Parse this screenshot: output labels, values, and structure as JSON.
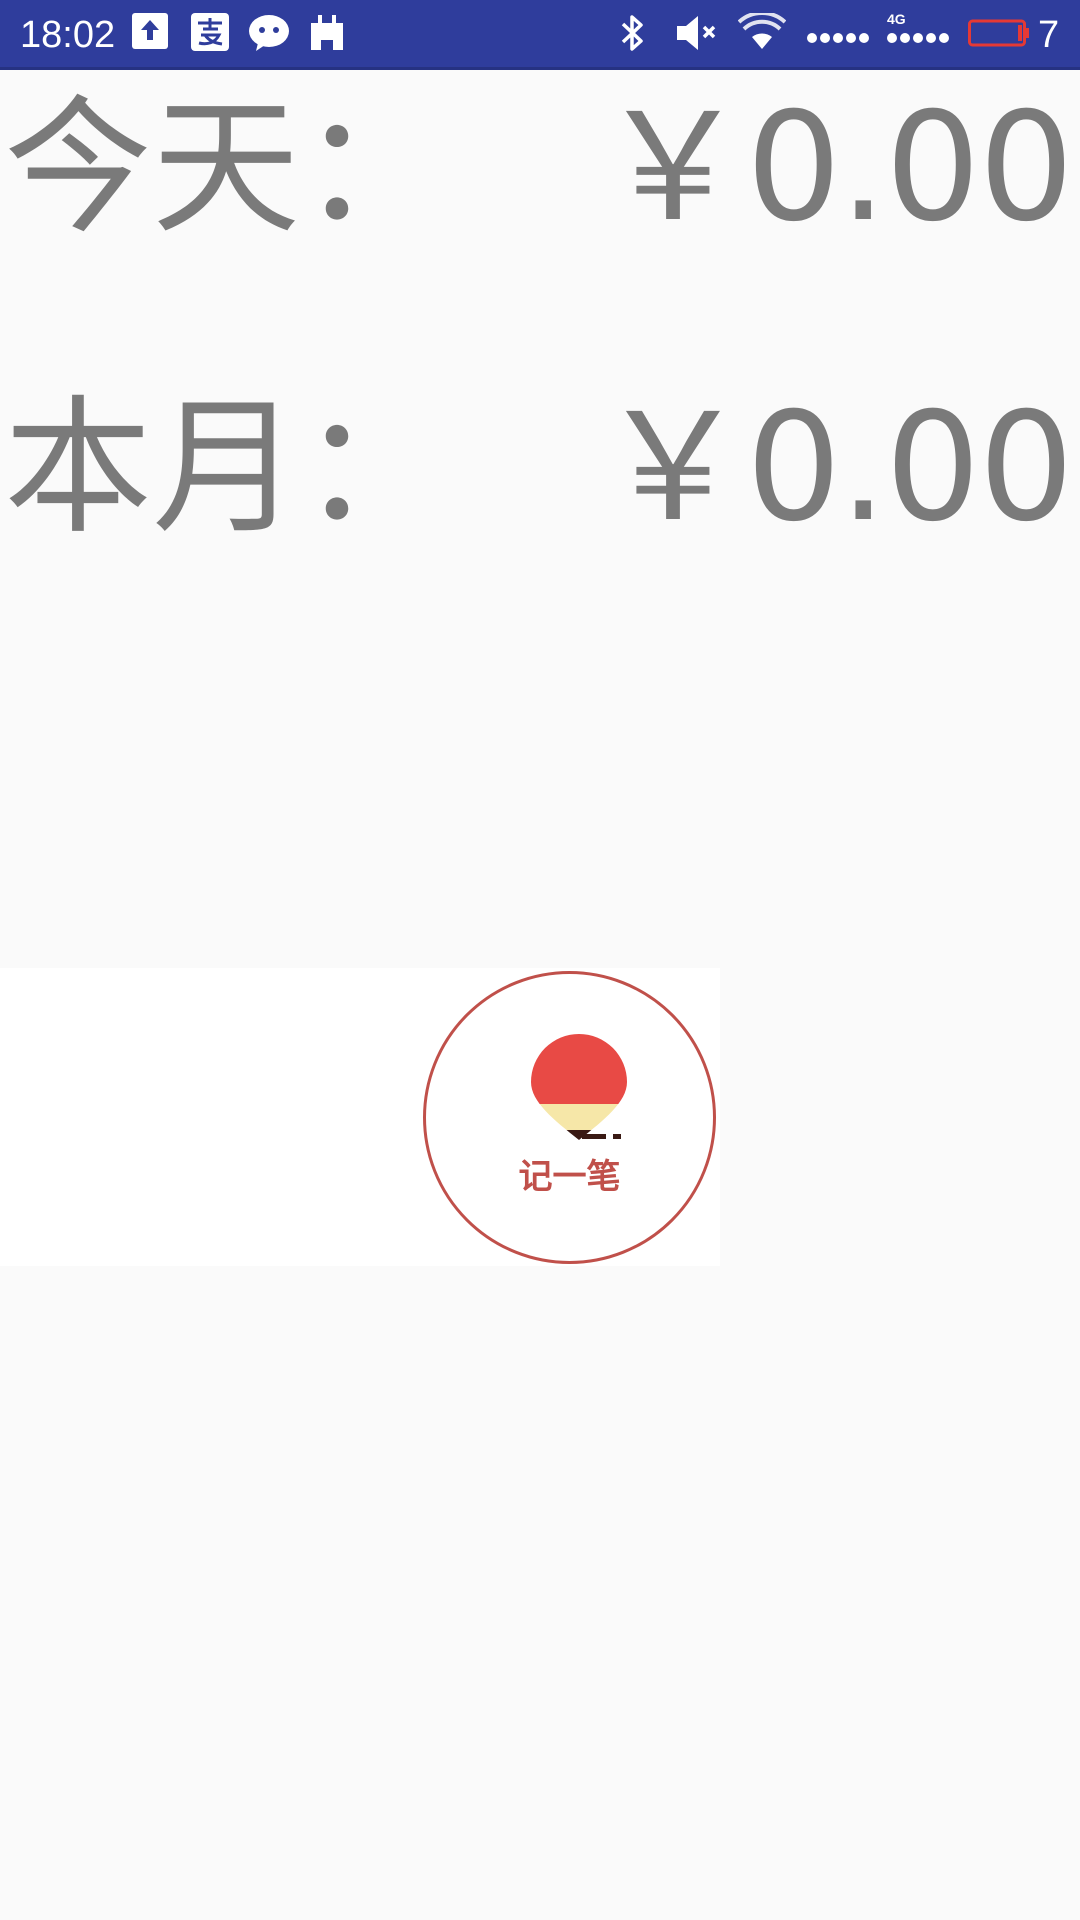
{
  "status_bar": {
    "time": "18:02",
    "notification_icons": [
      "upload-icon",
      "alipay-icon",
      "wechat-icon",
      "calendar-icon"
    ],
    "system_icons": [
      "bluetooth-icon",
      "mute-icon",
      "wifi-icon",
      "signal-icon",
      "battery-icon"
    ],
    "network_type": "4G",
    "battery_level": "7",
    "colors": {
      "background": "#2f3d9c",
      "battery_low": "#e53935"
    }
  },
  "summary": {
    "today_label": "今天：",
    "today_amount": "￥0.00",
    "month_label": "本月：",
    "month_amount": "￥0.00"
  },
  "record_button": {
    "label": "记一笔",
    "logo": "hot-air-balloon-icon",
    "colors": {
      "ring": "#c0504a",
      "balloon": "#e84a45",
      "band": "#f6e7a8",
      "base": "#3a1a14"
    }
  }
}
